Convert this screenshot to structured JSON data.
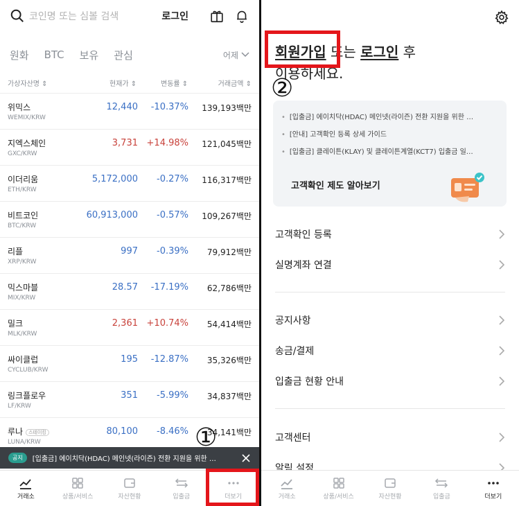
{
  "left": {
    "search_placeholder": "코인명 또는 심볼 검색",
    "login_label": "로그인",
    "tabs": [
      "원화",
      "BTC",
      "보유",
      "관심"
    ],
    "sort_label": "어제",
    "columns": {
      "name": "가상자산명 ⇕",
      "price": "현재가 ⇕",
      "change": "변동률 ⇕",
      "volume": "거래금액 ⇕"
    },
    "rows": [
      {
        "name": "위믹스",
        "pair": "WEMIX/KRW",
        "price": "12,440",
        "change": "-10.37%",
        "volume": "139,193백만",
        "dir": "down"
      },
      {
        "name": "지엑스체인",
        "pair": "GXC/KRW",
        "price": "3,731",
        "change": "+14.98%",
        "volume": "121,045백만",
        "dir": "up"
      },
      {
        "name": "이더리움",
        "pair": "ETH/KRW",
        "price": "5,172,000",
        "change": "-0.27%",
        "volume": "116,317백만",
        "dir": "down"
      },
      {
        "name": "비트코인",
        "pair": "BTC/KRW",
        "price": "60,913,000",
        "change": "-0.57%",
        "volume": "109,267백만",
        "dir": "down"
      },
      {
        "name": "리플",
        "pair": "XRP/KRW",
        "price": "997",
        "change": "-0.39%",
        "volume": "79,912백만",
        "dir": "down"
      },
      {
        "name": "믹스마블",
        "pair": "MIX/KRW",
        "price": "28.57",
        "change": "-17.19%",
        "volume": "62,786백만",
        "dir": "down"
      },
      {
        "name": "밀크",
        "pair": "MLK/KRW",
        "price": "2,361",
        "change": "+10.74%",
        "volume": "54,414백만",
        "dir": "up"
      },
      {
        "name": "싸이클럽",
        "pair": "CYCLUB/KRW",
        "price": "195",
        "change": "-12.87%",
        "volume": "35,326백만",
        "dir": "down"
      },
      {
        "name": "링크플로우",
        "pair": "LF/KRW",
        "price": "351",
        "change": "-5.99%",
        "volume": "34,837백만",
        "dir": "down"
      },
      {
        "name": "루나",
        "pair": "LUNA/KRW",
        "price": "80,100",
        "change": "-8.46%",
        "volume": "34,141백만",
        "dir": "down",
        "tag": "스테이킹"
      }
    ],
    "notice": {
      "badge": "공지",
      "text": "[입출금] 에이치닥(HDAC) 메인넷(라이즌) 전환 지원을 위한 …"
    },
    "annotation_number": "①"
  },
  "nav": [
    "거래소",
    "상품/서비스",
    "자산현황",
    "입출금",
    "더보기"
  ],
  "right": {
    "welcome": {
      "signup": "회원가입",
      "or": " 또는 ",
      "login": "로그인",
      "after": " 후",
      "line2": "이용하세요."
    },
    "notices": [
      "[입출금] 에이치닥(HDAC) 메인넷(라이즌) 전환 지원을 위한 …",
      "[안내] 고객확인 등록 상세 가이드",
      "[입출금] 클레이튼(KLAY) 및 클레이튼계열(KCT7) 입출금 일…"
    ],
    "verify_link": "고객확인 제도 알아보기",
    "menu": [
      "고객확인 등록",
      "실명계좌 연결",
      "공지사항",
      "송금/결제",
      "입출금 현황 안내",
      "고객센터",
      "알림 설정"
    ],
    "annotation_number": "②"
  },
  "colors": {
    "up": "#c8423b",
    "down": "#3a6fc4",
    "highlight": "#e4161b",
    "notice_bar": "#3b3f44"
  }
}
